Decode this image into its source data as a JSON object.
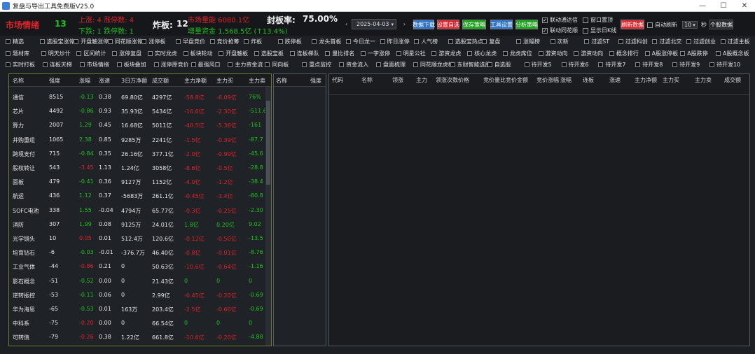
{
  "window": {
    "title": "复盘与导出工具免费版V25.0",
    "buttons": [
      "—",
      "☐",
      "✕"
    ]
  },
  "header": {
    "mood_label": "市场情绪",
    "mood_value": "13",
    "up_limit": "上涨: 4 涨停数: 4",
    "down_limit": "下跌: 1 跌停数: 1",
    "zhaban_label": "炸板:",
    "zhaban_value": "12",
    "amount_top": "市场量能 6080.1亿",
    "amount_bottom": "增量资金 1,568.5亿 (↑13.4%)",
    "fengban_label": "封板率:",
    "fengban_value": "75.00%",
    "date": "2025-04-03",
    "btn_a": "数据下载",
    "btn_b": "设置自选",
    "btn_c": "保存策略",
    "btn_d": "工具设置",
    "btn_e": "分析策略",
    "chk_linkage": "联动通达信",
    "chk_window": "窗口置顶",
    "chk_linkage2": "联动同花顺",
    "chk_show": "显示日K线",
    "btn_refresh": "刷新数据",
    "auto_refresh": "自动刷新",
    "interval": "10",
    "interval_unit": "秒",
    "btn_rank": "个股数据"
  },
  "colors": {
    "green_btn": "#1aa21a",
    "red_btn": "#d9262c",
    "blue_btn": "#2c73c9",
    "panel_border": "#6b7d2e"
  },
  "filters": {
    "row1": [
      "精选",
      "选股宝涨停",
      "开盘触涨停",
      "同花顺涨停",
      "涨停板",
      "早盘竞价",
      "竞价抢筹",
      "炸板",
      "跌停板",
      "龙头首板",
      "今日龙一",
      "昨日涨停",
      "人气榜",
      "选股宝热点",
      "复盘",
      "涨幅榜",
      "次新",
      "过滤ST",
      "过滤科创",
      "过滤北交",
      "过滤创业",
      "过滤主板"
    ],
    "row2": [
      "题材库",
      "明天炒什",
      "区间统计",
      "涨停复盘",
      "实时龙虎",
      "板块轮动",
      "开盘触板",
      "选股宝板",
      "连板梯队",
      "量比排名",
      "一字涨停",
      "明星公社",
      "游资龙虎",
      "核心龙虎",
      "龙虎席位",
      "游资动向",
      "游资动向",
      "概念排行",
      "A股涨停板",
      "A股跌停",
      "A股概念板"
    ],
    "row3": [
      "实时打板",
      "连板天梯",
      "市场情绪",
      "板块叠加",
      "涨停原竞价",
      "最强风口",
      "主力资金流",
      "同向板",
      "重点监控",
      "资金流入",
      "盘面梳理",
      "同花顺龙虎榜",
      "东财智能选股",
      "自选股",
      "待开发5",
      "待开发6",
      "待开发7",
      "待开发8",
      "待开发9",
      "待开发10"
    ]
  },
  "left_table": {
    "headers": [
      "名称",
      "强度",
      "涨幅",
      "涨速",
      "3日万净额",
      "成交额",
      "主力净额",
      "主力买",
      "主力卖"
    ],
    "rows": [
      [
        "通信",
        "8515",
        "-0.13",
        "0.38",
        "69.80亿",
        "4297亿",
        "-58.8亿",
        "-6.09亿",
        "76%"
      ],
      [
        "芯片",
        "4492",
        "-0.86",
        "0.93",
        "35.93亿",
        "5434亿",
        "-16.6亿",
        "-2.30亿",
        "-511.6"
      ],
      [
        "算力",
        "2007",
        "1.29",
        "0.45",
        "16.68亿",
        "5011亿",
        "-40.5亿",
        "-5.36亿",
        "-161"
      ],
      [
        "并购重组",
        "1065",
        "2.38",
        "0.85",
        "9285万",
        "2241亿",
        "-1.5亿",
        "-0.39亿",
        "-87.7"
      ],
      [
        "跨境支付",
        "715",
        "-0.84",
        "0.35",
        "26.16亿",
        "377.1亿",
        "-2.0亿",
        "-0.99亿",
        "-45.6"
      ],
      [
        "股权转让",
        "543",
        "-3.45",
        "1.13",
        "1.24亿",
        "3058亿",
        "-8.6亿",
        "-0.5亿",
        "-28.8"
      ],
      [
        "面板",
        "479",
        "-0.41",
        "0.36",
        "9127万",
        "1152亿",
        "-4.0亿",
        "-1.2亿",
        "-38.4"
      ],
      [
        "航运",
        "436",
        "1.12",
        "0.37",
        "-5683万",
        "261.1亿",
        "-0.45亿",
        "-3.4亿",
        "-80.8"
      ],
      [
        "SOFC电池",
        "338",
        "1.55",
        "-0.04",
        "4794万",
        "65.77亿",
        "-0.3亿",
        "-0.25亿",
        "-2.30"
      ],
      [
        "消防",
        "307",
        "1.99",
        "0.08",
        "9125万",
        "24.01亿",
        "1.8亿",
        "0.20亿",
        "9.02"
      ],
      [
        "光学镜头",
        "10",
        "0.05",
        "0.01",
        "512.4万",
        "120.6亿",
        "-0.12亿",
        "-0.50亿",
        "-13.5"
      ],
      [
        "培育钻石",
        "-6",
        "-0.03",
        "-0.01",
        "-376.7万",
        "46.40亿",
        "-0.8亿",
        "-0.01亿",
        "-8.76"
      ],
      [
        "工业气体",
        "-44",
        "-0.86",
        "0.21",
        "0",
        "50.63亿",
        "-10.6亿",
        "-0.64亿",
        "-1.16"
      ],
      [
        "影石概念",
        "-51",
        "-0.52",
        "0.00",
        "0",
        "21.43亿",
        "0",
        "0",
        "0"
      ],
      [
        "逆转振控",
        "-53",
        "-0.11",
        "0.06",
        "0",
        "2.99亿",
        "-0.45亿",
        "-0.20亿",
        "-0.69"
      ],
      [
        "华为海思",
        "-65",
        "-0.53",
        "0.01",
        "163万",
        "203.4亿",
        "-2.5亿",
        "-0.60亿",
        "-0.69"
      ],
      [
        "中科系",
        "-75",
        "-0.20",
        "0.00",
        "0",
        "66.54亿",
        "0",
        "0",
        "0"
      ],
      [
        "可转债",
        "-79",
        "-0.26",
        "0.38",
        "1.22亿",
        "661.8亿",
        "-10.6亿",
        "-0.20亿",
        "-4.88"
      ]
    ],
    "red_cols": [
      6,
      7
    ],
    "pct_col_colors": [
      "green",
      "green",
      "green",
      "green",
      "green",
      "red",
      "green",
      "green",
      "green",
      "green",
      "red",
      "green",
      "red",
      "green",
      "green",
      "green",
      "red",
      "red"
    ]
  },
  "mid_table": {
    "headers": [
      "名称",
      "强度"
    ]
  },
  "right_table": {
    "headers": [
      "代码",
      "名称",
      "领涨",
      "主力",
      "领涨次数",
      "价格",
      "竞价量比",
      "竞价金额",
      "竞价涨幅",
      "涨幅",
      "连板",
      "涨速",
      "主力净额",
      "主力买",
      "主力卖",
      "成交额"
    ]
  }
}
